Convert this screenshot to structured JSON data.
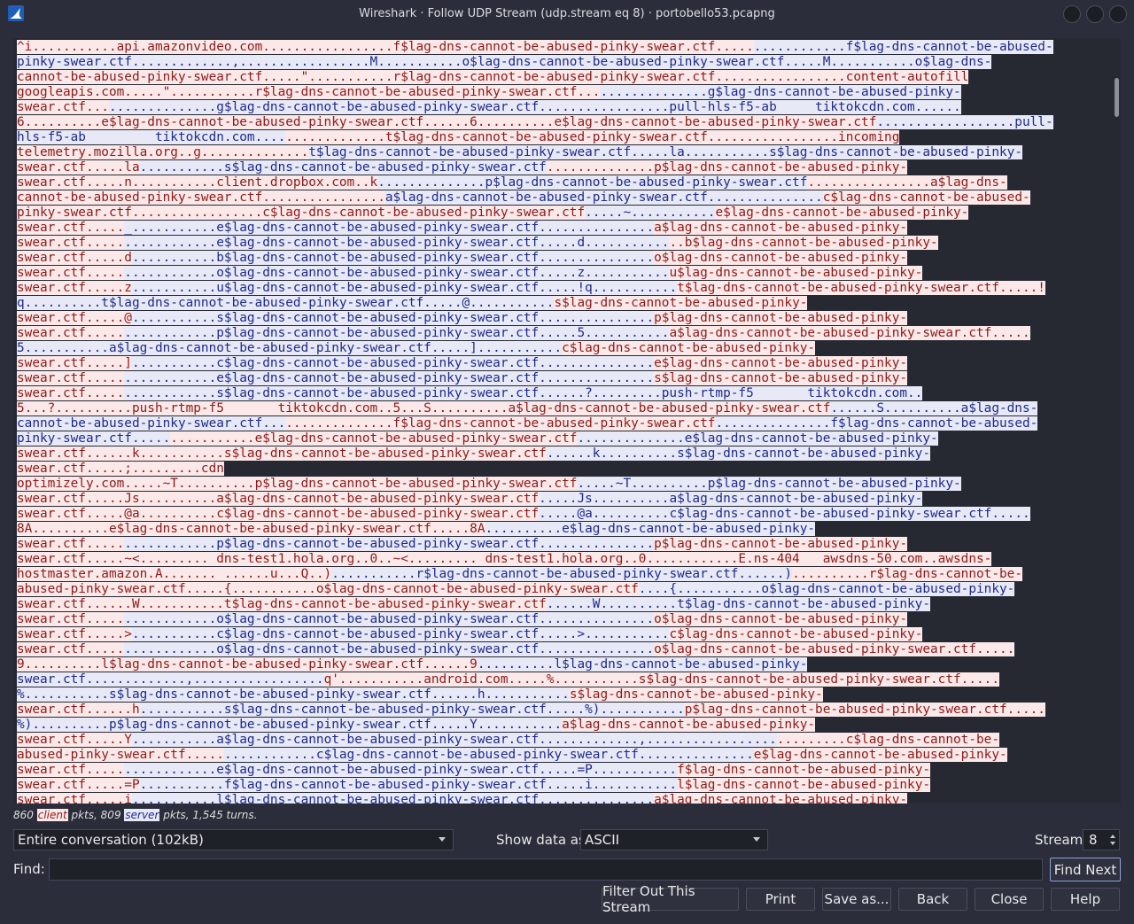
{
  "window": {
    "title": "Wireshark · Follow UDP Stream (udp.stream eq 8) · portobello53.pcapng"
  },
  "stream_lines": [
    [
      [
        "c",
        "^i...........api.amazonvideo.com.................f$lag-dns-cannot-be-abused-pinky-swear.ctf....."
      ],
      [
        "s",
        "............f$lag-dns-cannot-be-abused-"
      ]
    ],
    [
      [
        "s",
        "pinky-swear.ctf.............,.................M...........o$lag-dns-cannot-be-abused-pinky-swear.ctf.....M...........o$lag-dns-"
      ]
    ],
    [
      [
        "c",
        "cannot-be-abused-pinky-swear.ctf.....\"...........r$lag-dns-cannot-be-abused-pinky-swear.ctf.................content-autofill"
      ]
    ],
    [
      [
        "c",
        "googleapis.com.....\"...........r$lag-dns-cannot-be-abused-pinky-swear.ctf..."
      ],
      [
        "s",
        "..............g$lag-dns-cannot-be-abused-pinky-"
      ]
    ],
    [
      [
        "c",
        "swear.ctf..."
      ],
      [
        "s",
        "..............g$lag-dns-cannot-be-abused-pinky-swear.ctf.................pull-hls-f5-ab     tiktokcdn.com......"
      ]
    ],
    [
      [
        "c",
        "6..........e$lag-dns-cannot-be-abused-pinky-swear.ctf......6..........e$lag-dns-cannot-be-abused-pinky-swear.ctf"
      ],
      [
        "s",
        "..................pull-"
      ]
    ],
    [
      [
        "s",
        "hls-f5-ab         tiktokcdn.com...."
      ],
      [
        "c",
        ".............t$lag-dns-cannot-be-abused-pinky-swear.ctf.................incoming"
      ]
    ],
    [
      [
        "c",
        "telemetry.mozilla.org..g.............."
      ],
      [
        "s",
        "t$lag-dns-cannot-be-abused-pinky-swear.ctf.....la...........s$lag-dns-cannot-be-abused-pinky-"
      ]
    ],
    [
      [
        "c",
        "swear.ctf.....la"
      ],
      [
        "s",
        "...........s$lag-dns-cannot-be-abused-pinky-swear.ctf"
      ],
      [
        "c",
        "..............p$lag-dns-cannot-be-abused-pinky-"
      ]
    ],
    [
      [
        "c",
        "swear.ctf.....n...........client.dropbox.com..k"
      ],
      [
        "s",
        "..............p$lag-dns-cannot-be-abused-pinky-swear.ctf"
      ],
      [
        "c",
        "................a$lag-dns-"
      ]
    ],
    [
      [
        "c",
        "cannot-be-abused-pinky-swear.ctf................"
      ],
      [
        "s",
        "a$lag-dns-cannot-be-abused-pinky-swear.ctf..............."
      ],
      [
        "c",
        "c$lag-dns-cannot-be-abused-"
      ]
    ],
    [
      [
        "c",
        "pinky-swear.ctf.................c$lag-dns-cannot-be-abused-pinky-swear.ctf"
      ],
      [
        "s",
        ".....~..........."
      ],
      [
        "c",
        "e$lag-dns-cannot-be-abused-pinky-"
      ]
    ],
    [
      [
        "c",
        "swear.ctf....."
      ],
      [
        "s",
        "_...........e$lag-dns-cannot-be-abused-pinky-swear.ctf..............."
      ],
      [
        "c",
        "a$lag-dns-cannot-be-abused-pinky-"
      ]
    ],
    [
      [
        "c",
        "swear.ctf....."
      ],
      [
        "s",
        "............e$lag-dns-cannot-be-abused-pinky-swear.ctf.....d..........."
      ],
      [
        "c",
        "..b$lag-dns-cannot-be-abused-pinky-"
      ]
    ],
    [
      [
        "c",
        "swear.ctf.....d"
      ],
      [
        "s",
        "...........b$lag-dns-cannot-be-abused-pinky-swear.ctf..............."
      ],
      [
        "c",
        "o$lag-dns-cannot-be-abused-pinky-"
      ]
    ],
    [
      [
        "c",
        "swear.ctf....."
      ],
      [
        "s",
        "............o$lag-dns-cannot-be-abused-pinky-swear.ctf.....z..........."
      ],
      [
        "c",
        "u$lag-dns-cannot-be-abused-pinky-"
      ]
    ],
    [
      [
        "c",
        "swear.ctf.....z"
      ],
      [
        "s",
        "...........u$lag-dns-cannot-be-abused-pinky-swear.ctf.....!q..........."
      ],
      [
        "c",
        "t$lag-dns-cannot-be-abused-pinky-swear.ctf.....!"
      ]
    ],
    [
      [
        "s",
        "q..........t$lag-dns-cannot-be-abused-pinky-swear.ctf.....@..........."
      ],
      [
        "c",
        "s$lag-dns-cannot-be-abused-pinky-"
      ]
    ],
    [
      [
        "c",
        "swear.ctf.....@"
      ],
      [
        "s",
        "...........s$lag-dns-cannot-be-abused-pinky-swear.ctf..............."
      ],
      [
        "c",
        "p$lag-dns-cannot-be-abused-pinky-"
      ]
    ],
    [
      [
        "c",
        "swear.ctf....."
      ],
      [
        "s",
        "............p$lag-dns-cannot-be-abused-pinky-swear.ctf.....5..........."
      ],
      [
        "c",
        "a$lag-dns-cannot-be-abused-pinky-swear.ctf....."
      ]
    ],
    [
      [
        "s",
        "5...........a$lag-dns-cannot-be-abused-pinky-swear.ctf.....]..........."
      ],
      [
        "c",
        "c$lag-dns-cannot-be-abused-pinky-"
      ]
    ],
    [
      [
        "c",
        "swear.ctf.....]"
      ],
      [
        "s",
        "...........c$lag-dns-cannot-be-abused-pinky-swear.ctf..............."
      ],
      [
        "c",
        "e$lag-dns-cannot-be-abused-pinky-"
      ]
    ],
    [
      [
        "c",
        "swear.ctf....."
      ],
      [
        "s",
        "............e$lag-dns-cannot-be-abused-pinky-swear.ctf..............."
      ],
      [
        "c",
        "s$lag-dns-cannot-be-abused-pinky-"
      ]
    ],
    [
      [
        "c",
        "swear.ctf....."
      ],
      [
        "s",
        "............s$lag-dns-cannot-be-abused-pinky-swear.ctf......?.........push-rtmp-f5       tiktokcdn.com.."
      ]
    ],
    [
      [
        "c",
        "5...?..........push-rtmp-f5       tiktokcdn.com..5...S..........a$lag-dns-cannot-be-abused-pinky-swear.ctf"
      ],
      [
        "s",
        "......S..........a$lag-dns-"
      ]
    ],
    [
      [
        "s",
        "cannot-be-abused-pinky-swear.ctf..."
      ],
      [
        "c",
        "..............f$lag-dns-cannot-be-abused-pinky-swear.ctf"
      ],
      [
        "s",
        "...............f$lag-dns-cannot-be-abused-"
      ]
    ],
    [
      [
        "s",
        "pinky-swear.ctf....."
      ],
      [
        "c",
        "...........e$lag-dns-cannot-be-abused-pinky-swear.ctf"
      ],
      [
        "s",
        "..............e$lag-dns-cannot-be-abused-pinky-"
      ]
    ],
    [
      [
        "c",
        "swear.ctf......k...........s$lag-dns-cannot-be-abused-pinky-swear.ctf"
      ],
      [
        "s",
        "......k..........s$lag-dns-cannot-be-abused-pinky-"
      ]
    ],
    [
      [
        "c",
        "swear.ctf.....;.........cdn"
      ]
    ],
    [
      [
        "c",
        "optimizely.com.....~T..........p$lag-dns-cannot-be-abused-pinky-swear.ctf"
      ],
      [
        "s",
        ".....~T..........p$lag-dns-cannot-be-abused-pinky-"
      ]
    ],
    [
      [
        "c",
        "swear.ctf.....Js..........a$lag-dns-cannot-be-abused-pinky-swear.ctf"
      ],
      [
        "s",
        ".....Js..........a$lag-dns-cannot-be-abused-pinky-"
      ]
    ],
    [
      [
        "c",
        "swear.ctf.....@a..........c$lag-dns-cannot-be-abused-pinky-swear.ctf"
      ],
      [
        "s",
        ".....@a..........c$lag-dns-cannot-be-abused-pinky-swear.ctf....."
      ]
    ],
    [
      [
        "c",
        "8A..........e$lag-dns-cannot-be-abused-pinky-swear.ctf.....8A"
      ],
      [
        "s",
        "..........e$lag-dns-cannot-be-abused-pinky-"
      ]
    ],
    [
      [
        "c",
        "swear.ctf....."
      ],
      [
        "s",
        "............p$lag-dns-cannot-be-abused-pinky-swear.ctf..............."
      ],
      [
        "c",
        "p$lag-dns-cannot-be-abused-pinky-"
      ]
    ],
    [
      [
        "c",
        "swear.ctf.....~<......... dns-test1.hola.org..0..~<......... dns-test1.hola.org..0............E.ns-404   awsdns-50.com..awsdns-"
      ]
    ],
    [
      [
        "c",
        "hostmaster.amazon.A....... ......u...Q..)"
      ],
      [
        "s",
        "...........r$lag-dns-cannot-be-abused-pinky-swear.ctf......)"
      ],
      [
        "c",
        "..........r$lag-dns-cannot-be-"
      ]
    ],
    [
      [
        "c",
        "abused-pinky-swear.ctf.....{...........o$lag-dns-cannot-be-abused-pinky-swear.ctf"
      ],
      [
        "s",
        "....{...........o$lag-dns-cannot-be-abused-pinky-"
      ]
    ],
    [
      [
        "c",
        "swear.ctf......W...........t$lag-dns-cannot-be-abused-pinky-swear.ctf"
      ],
      [
        "s",
        "......W..........t$lag-dns-cannot-be-abused-pinky-"
      ]
    ],
    [
      [
        "c",
        "swear.ctf....."
      ],
      [
        "s",
        "............o$lag-dns-cannot-be-abused-pinky-swear.ctf..............."
      ],
      [
        "c",
        "o$lag-dns-cannot-be-abused-pinky-"
      ]
    ],
    [
      [
        "c",
        "swear.ctf.....>"
      ],
      [
        "s",
        "...........c$lag-dns-cannot-be-abused-pinky-swear.ctf.....>..........."
      ],
      [
        "c",
        "c$lag-dns-cannot-be-abused-pinky-"
      ]
    ],
    [
      [
        "c",
        "swear.ctf....."
      ],
      [
        "s",
        "............o$lag-dns-cannot-be-abused-pinky-swear.ctf..............."
      ],
      [
        "c",
        "o$lag-dns-cannot-be-abused-pinky-swear.ctf....."
      ]
    ],
    [
      [
        "c",
        "9..........l$lag-dns-cannot-be-abused-pinky-swear.ctf......9"
      ],
      [
        "s",
        "..........l$lag-dns-cannot-be-abused-pinky-"
      ]
    ],
    [
      [
        "s",
        "swear.ctf.............,................."
      ],
      [
        "c",
        "q'...........android.com.....%...........s$lag-dns-cannot-be-abused-pinky-swear.ctf....."
      ]
    ],
    [
      [
        "s",
        "%...........s$lag-dns-cannot-be-abused-pinky-swear.ctf......h..........."
      ],
      [
        "c",
        "s$lag-dns-cannot-be-abused-pinky-"
      ]
    ],
    [
      [
        "c",
        "swear.ctf......h"
      ],
      [
        "s",
        "...........s$lag-dns-cannot-be-abused-pinky-swear.ctf.....%)..........."
      ],
      [
        "c",
        "p$lag-dns-cannot-be-abused-pinky-swear.ctf....."
      ]
    ],
    [
      [
        "s",
        "%)..........p$lag-dns-cannot-be-abused-pinky-swear.ctf.....Y..........."
      ],
      [
        "c",
        "a$lag-dns-cannot-be-abused-pinky-"
      ]
    ],
    [
      [
        "c",
        "swear.ctf.....Y"
      ],
      [
        "s",
        "...........a$lag-dns-cannot-be-abused-pinky-swear.ctf.............,................."
      ],
      [
        "c",
        ".........c$lag-dns-cannot-be-"
      ]
    ],
    [
      [
        "c",
        "abused-pinky-swear.ctf....."
      ],
      [
        "s",
        "............c$lag-dns-cannot-be-abused-pinky-swear.ctf..............."
      ],
      [
        "c",
        "e$lag-dns-cannot-be-abused-pinky-"
      ]
    ],
    [
      [
        "c",
        "swear.ctf....."
      ],
      [
        "s",
        "............e$lag-dns-cannot-be-abused-pinky-swear.ctf.....=P..........."
      ],
      [
        "c",
        "f$lag-dns-cannot-be-abused-pinky-"
      ]
    ],
    [
      [
        "c",
        "swear.ctf.....=P"
      ],
      [
        "s",
        "...........f$lag-dns-cannot-be-abused-pinky-swear.ctf.....i..........."
      ],
      [
        "c",
        "l$lag-dns-cannot-be-abused-pinky-"
      ]
    ],
    [
      [
        "c",
        "swear.ctf.....i"
      ],
      [
        "s",
        "...........l$lag-dns-cannot-be-abused-pinky-swear.ctf..............."
      ],
      [
        "c",
        "a$lag-dns-cannot-be-abused-pinky-"
      ]
    ]
  ],
  "stats": {
    "client_count": "860",
    "client_label": "client",
    "mid": " pkts, 809 ",
    "server_label": "server",
    "tail": " pkts, 1,545 turns."
  },
  "controls": {
    "conversation_value": "Entire conversation (102kB)",
    "show_data_label": "Show data as",
    "show_data_value": "ASCII",
    "stream_label": "Stream",
    "stream_value": "8",
    "find_label": "Find:",
    "find_value": "",
    "find_next": "Find Next"
  },
  "buttons": {
    "filter_out": "Filter Out This Stream",
    "print": "Print",
    "save_as": "Save as...",
    "back": "Back",
    "close": "Close",
    "help": "Help"
  },
  "colors": {
    "client_bg": "#fbe9e9",
    "client_fg": "#8c1a1a",
    "server_bg": "#e7e9f7",
    "server_fg": "#1f2a88",
    "window_bg": "#2b2e3a"
  }
}
